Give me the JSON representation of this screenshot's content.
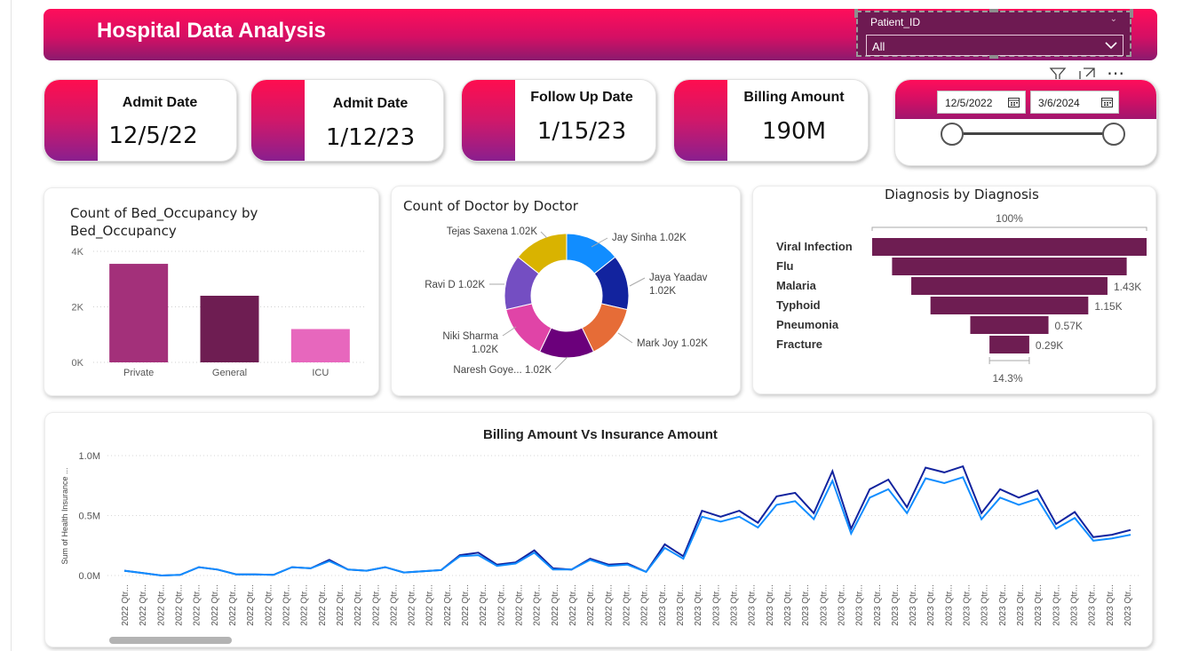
{
  "header": {
    "title": "Hospital Data Analysis",
    "slicer_label": "Patient_ID",
    "slicer_value": "All"
  },
  "visual_toolbar": {
    "icons": [
      "filter-icon",
      "focus-mode-icon",
      "more-options-icon"
    ],
    "more": "⋯"
  },
  "kpis": [
    {
      "title": "Admit Date",
      "value": "12/5/22"
    },
    {
      "title": "Admit Date",
      "value": "1/12/23"
    },
    {
      "title": "Follow Up Date",
      "value": "1/15/23"
    },
    {
      "title": "Billing Amount",
      "value": "190M"
    }
  ],
  "date_range": {
    "start": "12/5/2022",
    "end": "3/6/2024"
  },
  "colors": {
    "magenta": "#ff0d5a",
    "plum": "#6e1a52",
    "purple": "#8a1f8e",
    "wine": "#6e1d5a"
  },
  "chart_data": [
    {
      "type": "bar",
      "title": "Count of Bed_Occupancy by Bed_Occupancy",
      "title_lines": [
        "Count of Bed_Occupancy by",
        "Bed_Occupancy"
      ],
      "categories": [
        "Private",
        "General",
        "ICU"
      ],
      "values": [
        3550,
        2400,
        1200
      ],
      "colors": [
        "#a3307a",
        "#6e1d52",
        "#e767bd"
      ],
      "yticks": [
        "0K",
        "2K",
        "4K"
      ],
      "ylim": [
        0,
        4000
      ],
      "grid": true
    },
    {
      "type": "pie",
      "title": "Count of Doctor by Doctor",
      "slices": [
        {
          "name": "Jay Sinha",
          "value": 1.02,
          "label": "Jay Sinha 1.02K",
          "color": "#118dff"
        },
        {
          "name": "Jaya Yaadav",
          "value": 1.02,
          "label": "Jaya Yaadav",
          "label2": "1.02K",
          "color": "#12239e"
        },
        {
          "name": "Mark Joy",
          "value": 1.02,
          "label": "Mark Joy 1.02K",
          "color": "#e66c37"
        },
        {
          "name": "Naresh Goye...",
          "value": 1.02,
          "label": "Naresh Goye... 1.02K",
          "color": "#6b007b"
        },
        {
          "name": "Niki Sharma",
          "value": 1.02,
          "label": "Niki Sharma",
          "label2": "1.02K",
          "color": "#e044a7"
        },
        {
          "name": "Ravi D",
          "value": 1.02,
          "label": "Ravi D 1.02K",
          "color": "#744ec2"
        },
        {
          "name": "Tejas Saxena",
          "value": 1.02,
          "label": "Tejas Saxena 1.02K",
          "color": "#d9b300"
        }
      ]
    },
    {
      "type": "bar",
      "subtype": "funnel",
      "title": "Diagnosis by Diagnosis",
      "top_label": "100%",
      "bottom_label": "14.3%",
      "color": "#6e1d52",
      "categories": [
        "Viral Infection",
        "Flu",
        "Malaria",
        "Typhoid",
        "Pneumonia",
        "Fracture"
      ],
      "values": [
        2.0,
        1.71,
        1.43,
        1.15,
        0.57,
        0.29
      ],
      "value_labels": [
        "",
        "",
        "1.43K",
        "1.15K",
        "0.57K",
        "0.29K"
      ]
    },
    {
      "type": "line",
      "title": "Billing Amount Vs Insurance Amount",
      "ylabel": "Sum of Health Insurance ...",
      "yticks": [
        "0.0M",
        "0.5M",
        "1.0M"
      ],
      "ylim": [
        0,
        1.0
      ],
      "x_tick_labels": [
        "2022 Qtr...",
        "2022 Qtr...",
        "2022 Qtr...",
        "2022 Qtr...",
        "2022 Qtr...",
        "2022 Qtr...",
        "2022 Qtr...",
        "2022 Qtr...",
        "2022 Qtr...",
        "2022 Qtr...",
        "2022 Qtr...",
        "2022 Qtr...",
        "2022 Qtr...",
        "2022 Qtr...",
        "2022 Qtr...",
        "2022 Qtr...",
        "2022 Qtr...",
        "2022 Qtr...",
        "2022 Qtr...",
        "2022 Qtr...",
        "2022 Qtr...",
        "2022 Qtr...",
        "2022 Qtr...",
        "2022 Qtr...",
        "2022 Qtr...",
        "2022 Qtr...",
        "2022 Qtr...",
        "2022 Qtr...",
        "2022 Qtr...",
        "2022 Qtr...",
        "2023 Qtr...",
        "2023 Qtr...",
        "2023 Qtr...",
        "2023 Qtr...",
        "2023 Qtr...",
        "2023 Qtr...",
        "2023 Qtr...",
        "2023 Qtr...",
        "2023 Qtr...",
        "2023 Qtr...",
        "2023 Qtr...",
        "2023 Qtr...",
        "2023 Qtr...",
        "2023 Qtr...",
        "2023 Qtr...",
        "2023 Qtr...",
        "2023 Qtr...",
        "2023 Qtr...",
        "2023 Qtr...",
        "2023 Qtr...",
        "2023 Qtr...",
        "2023 Qtr...",
        "2023 Qtr...",
        "2023 Qtr...",
        "2023 Qtr...",
        "2023 Qtr...",
        "2023 Qtr..."
      ],
      "series": [
        {
          "color": "#12239e",
          "values": [
            0.04,
            0.02,
            0.0,
            0.005,
            0.07,
            0.05,
            0.01,
            0.01,
            0.005,
            0.07,
            0.06,
            0.13,
            0.05,
            0.04,
            0.07,
            0.025,
            0.035,
            0.045,
            0.17,
            0.19,
            0.09,
            0.11,
            0.21,
            0.06,
            0.05,
            0.14,
            0.09,
            0.1,
            0.03,
            0.26,
            0.16,
            0.54,
            0.49,
            0.54,
            0.44,
            0.66,
            0.69,
            0.52,
            0.87,
            0.39,
            0.72,
            0.8,
            0.57,
            0.9,
            0.86,
            0.91,
            0.52,
            0.72,
            0.65,
            0.71,
            0.43,
            0.53,
            0.32,
            0.34,
            0.38
          ]
        },
        {
          "color": "#118dff",
          "values": [
            0.04,
            0.02,
            0.0,
            0.005,
            0.07,
            0.05,
            0.01,
            0.01,
            0.005,
            0.07,
            0.06,
            0.12,
            0.05,
            0.04,
            0.07,
            0.025,
            0.035,
            0.045,
            0.16,
            0.17,
            0.08,
            0.1,
            0.19,
            0.05,
            0.05,
            0.13,
            0.08,
            0.09,
            0.03,
            0.23,
            0.14,
            0.49,
            0.45,
            0.49,
            0.4,
            0.59,
            0.62,
            0.47,
            0.79,
            0.35,
            0.65,
            0.72,
            0.52,
            0.81,
            0.77,
            0.82,
            0.47,
            0.65,
            0.59,
            0.64,
            0.39,
            0.48,
            0.29,
            0.31,
            0.34
          ]
        }
      ]
    }
  ]
}
